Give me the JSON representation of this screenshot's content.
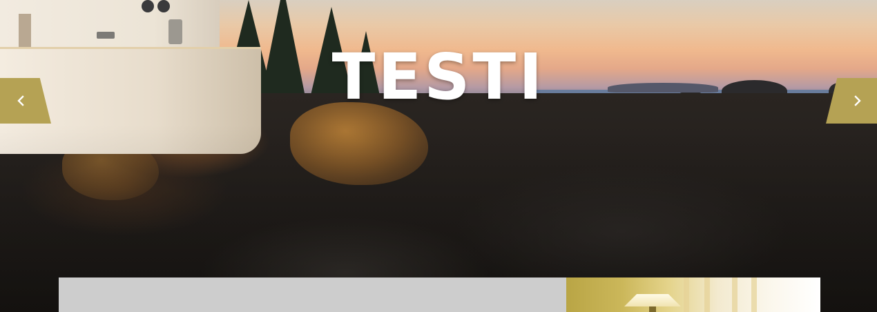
{
  "slider": {
    "title": "TESTI",
    "prev_icon": "chevron-left-icon",
    "next_icon": "chevron-right-icon",
    "accent_color": "#b5a254",
    "title_color": "#ffffff"
  },
  "panels": {
    "gray_panel_color": "#cdcdcd"
  }
}
